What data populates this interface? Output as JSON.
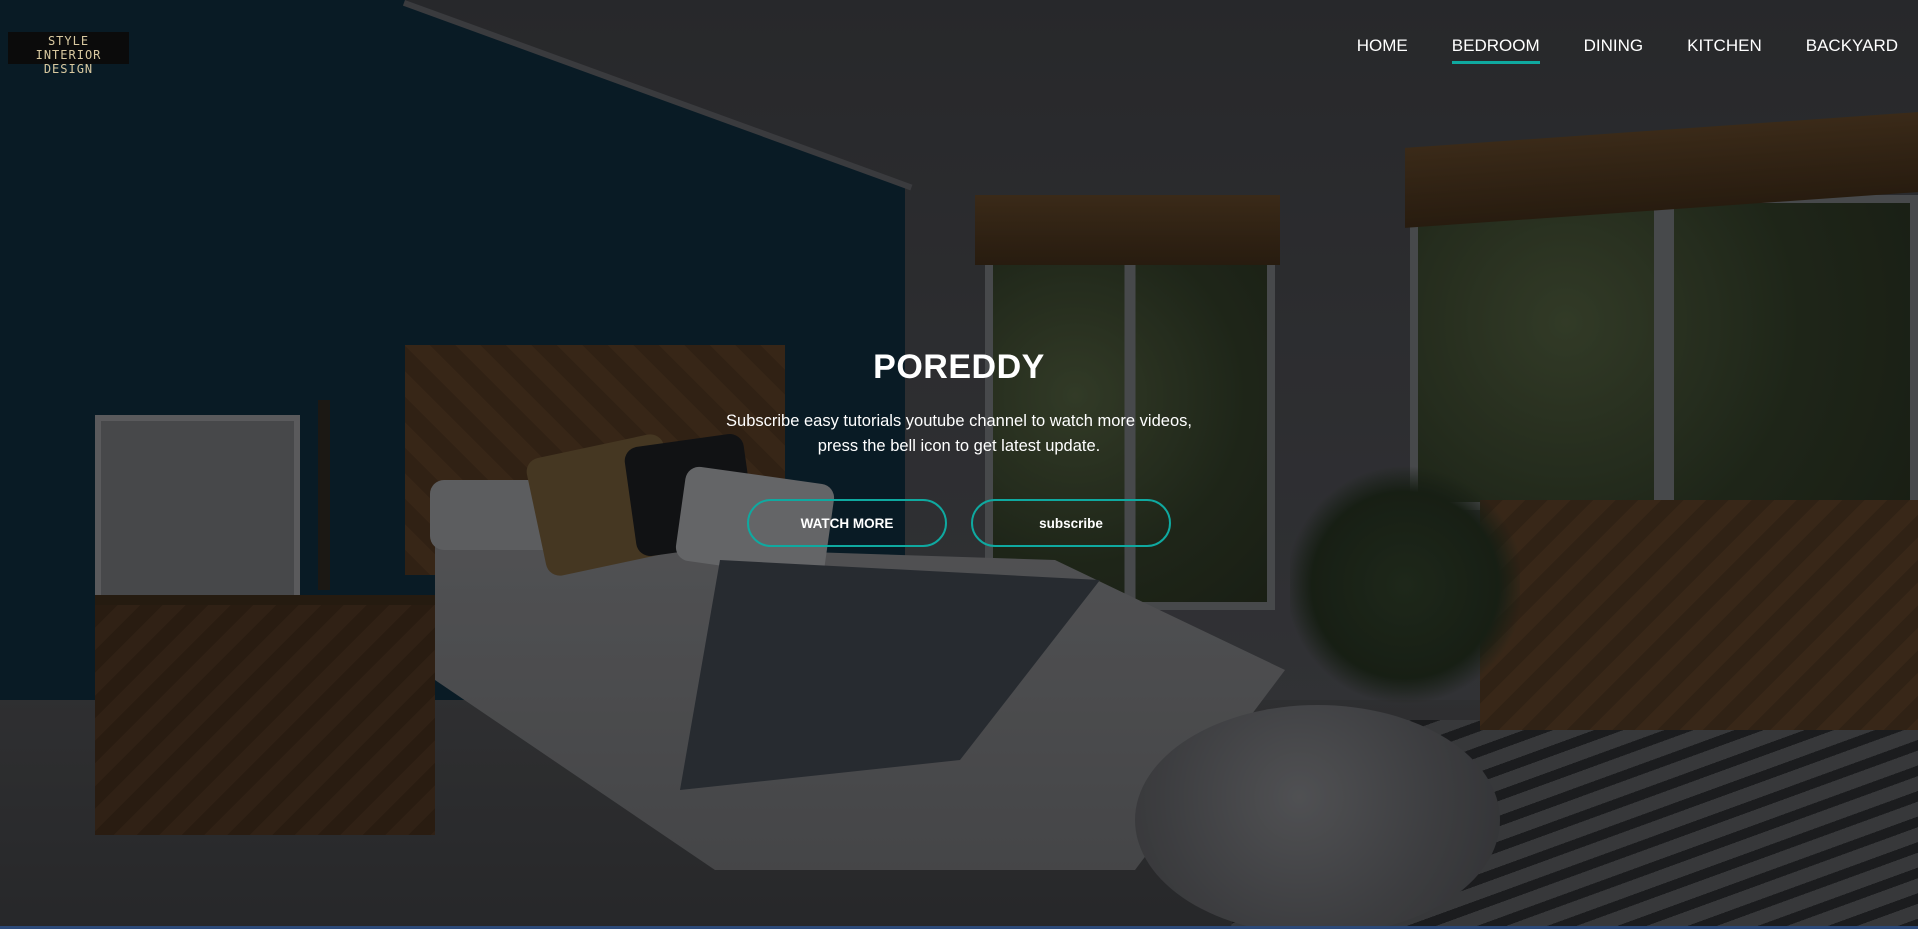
{
  "brand": {
    "logo_line1": "STYLE",
    "logo_line2": "INTERIOR DESIGN"
  },
  "nav": {
    "items": [
      {
        "label": "HOME",
        "active": false
      },
      {
        "label": "BEDROOM",
        "active": true
      },
      {
        "label": "DINING",
        "active": false
      },
      {
        "label": "KITCHEN",
        "active": false
      },
      {
        "label": "BACKYARD",
        "active": false
      }
    ]
  },
  "hero": {
    "title": "POREDDY",
    "subtitle_line1": "Subscribe easy tutorials youtube channel to watch more videos,",
    "subtitle_line2": "press the bell icon to get latest update.",
    "primary_button": "WATCH MORE",
    "secondary_button": "subscribe"
  },
  "colors": {
    "accent": "#0fa9a0",
    "text": "#ffffff",
    "overlay": "rgba(0,0,0,0.35)"
  }
}
